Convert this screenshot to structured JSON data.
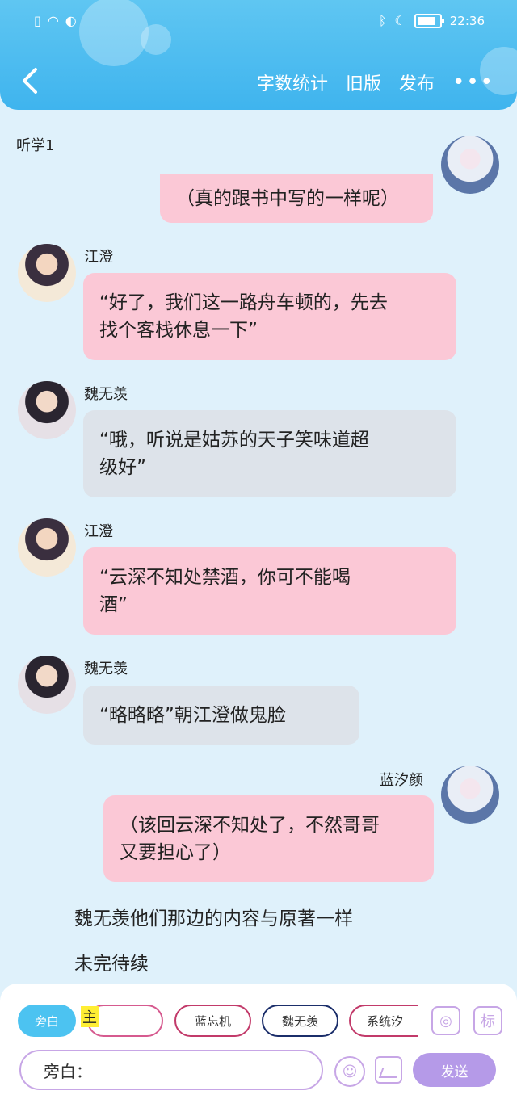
{
  "status": {
    "time": "22:36"
  },
  "nav": {
    "word_count": "字数统计",
    "old_version": "旧版",
    "publish": "发布",
    "more": "•••"
  },
  "chat_title": "听学1",
  "messages": [
    {
      "text": "（真的跟书中写的一样呢）"
    },
    {
      "name": "江澄",
      "line1": "“好了，我们这一路舟车顿的，先去",
      "line2": "找个客栈休息一下”"
    },
    {
      "name": "魏无羡",
      "line1": "“哦，听说是姑苏的天子笑味道超",
      "line2": "级好”"
    },
    {
      "name": "江澄",
      "line1": "“云深不知处禁酒，你可不能喝",
      "line2": "酒”"
    },
    {
      "name": "魏无羡",
      "line1": "“略略略”朝江澄做鬼脸"
    },
    {
      "name": "蓝汐颜",
      "line1": "（该回云深不知处了，不然哥哥",
      "line2": "又要担心了）"
    }
  ],
  "narration": [
    "魏无羡他们那边的内容与原著一样",
    "未完待续"
  ],
  "roles": [
    "旁白",
    "主",
    "蓝忘机",
    "魏无羡",
    "系统汐"
  ],
  "input": {
    "prefix": "旁白："
  },
  "icons": {
    "profile": "profile-icon",
    "tag": "标"
  },
  "send_label": "发送",
  "colors": {
    "header": "#3fb4ee",
    "pink_bubble": "#fbc8d6",
    "gray_bubble": "#dde3ea",
    "send": "#b59ae8"
  }
}
